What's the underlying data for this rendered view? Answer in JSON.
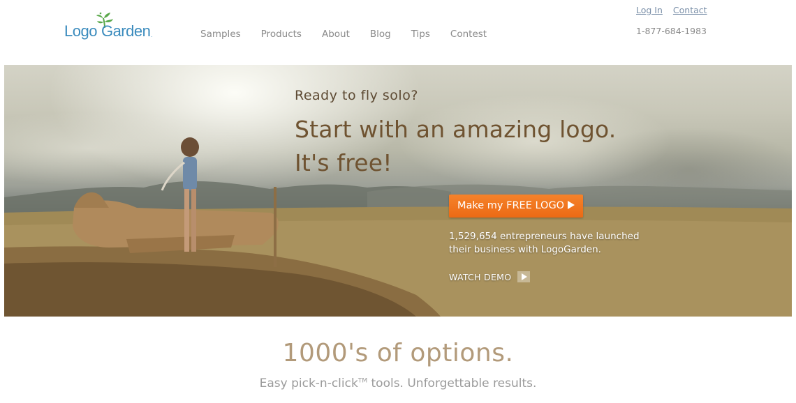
{
  "header": {
    "logo": {
      "text_left": "Logo",
      "text_right": "Garden",
      "suffix": "."
    },
    "nav": [
      "Samples",
      "Products",
      "About",
      "Blog",
      "Tips",
      "Contest"
    ],
    "top_links": {
      "login": "Log In",
      "contact": "Contact"
    },
    "phone": "1-877-684-1983"
  },
  "hero": {
    "tagline": "Ready to fly solo?",
    "headline_line1": "Start with an amazing logo.",
    "headline_line2": "It's free!",
    "cta_label": "Make my FREE LOGO",
    "stats_line1": "1,529,654 entrepreneurs have launched",
    "stats_line2": "their business with LogoGarden.",
    "watch_demo": "WATCH DEMO"
  },
  "options": {
    "title": "1000's of options.",
    "subtitle_part1": "Easy pick-n-click",
    "subtitle_tm": "TM",
    "subtitle_part2": " tools. Unforgettable results."
  },
  "colors": {
    "logo_blue": "#3a8bbd",
    "sprout_green": "#5aa84a",
    "cta_orange": "#f07520",
    "headline_brown": "#6f5331",
    "options_tan": "#b29a7a"
  }
}
